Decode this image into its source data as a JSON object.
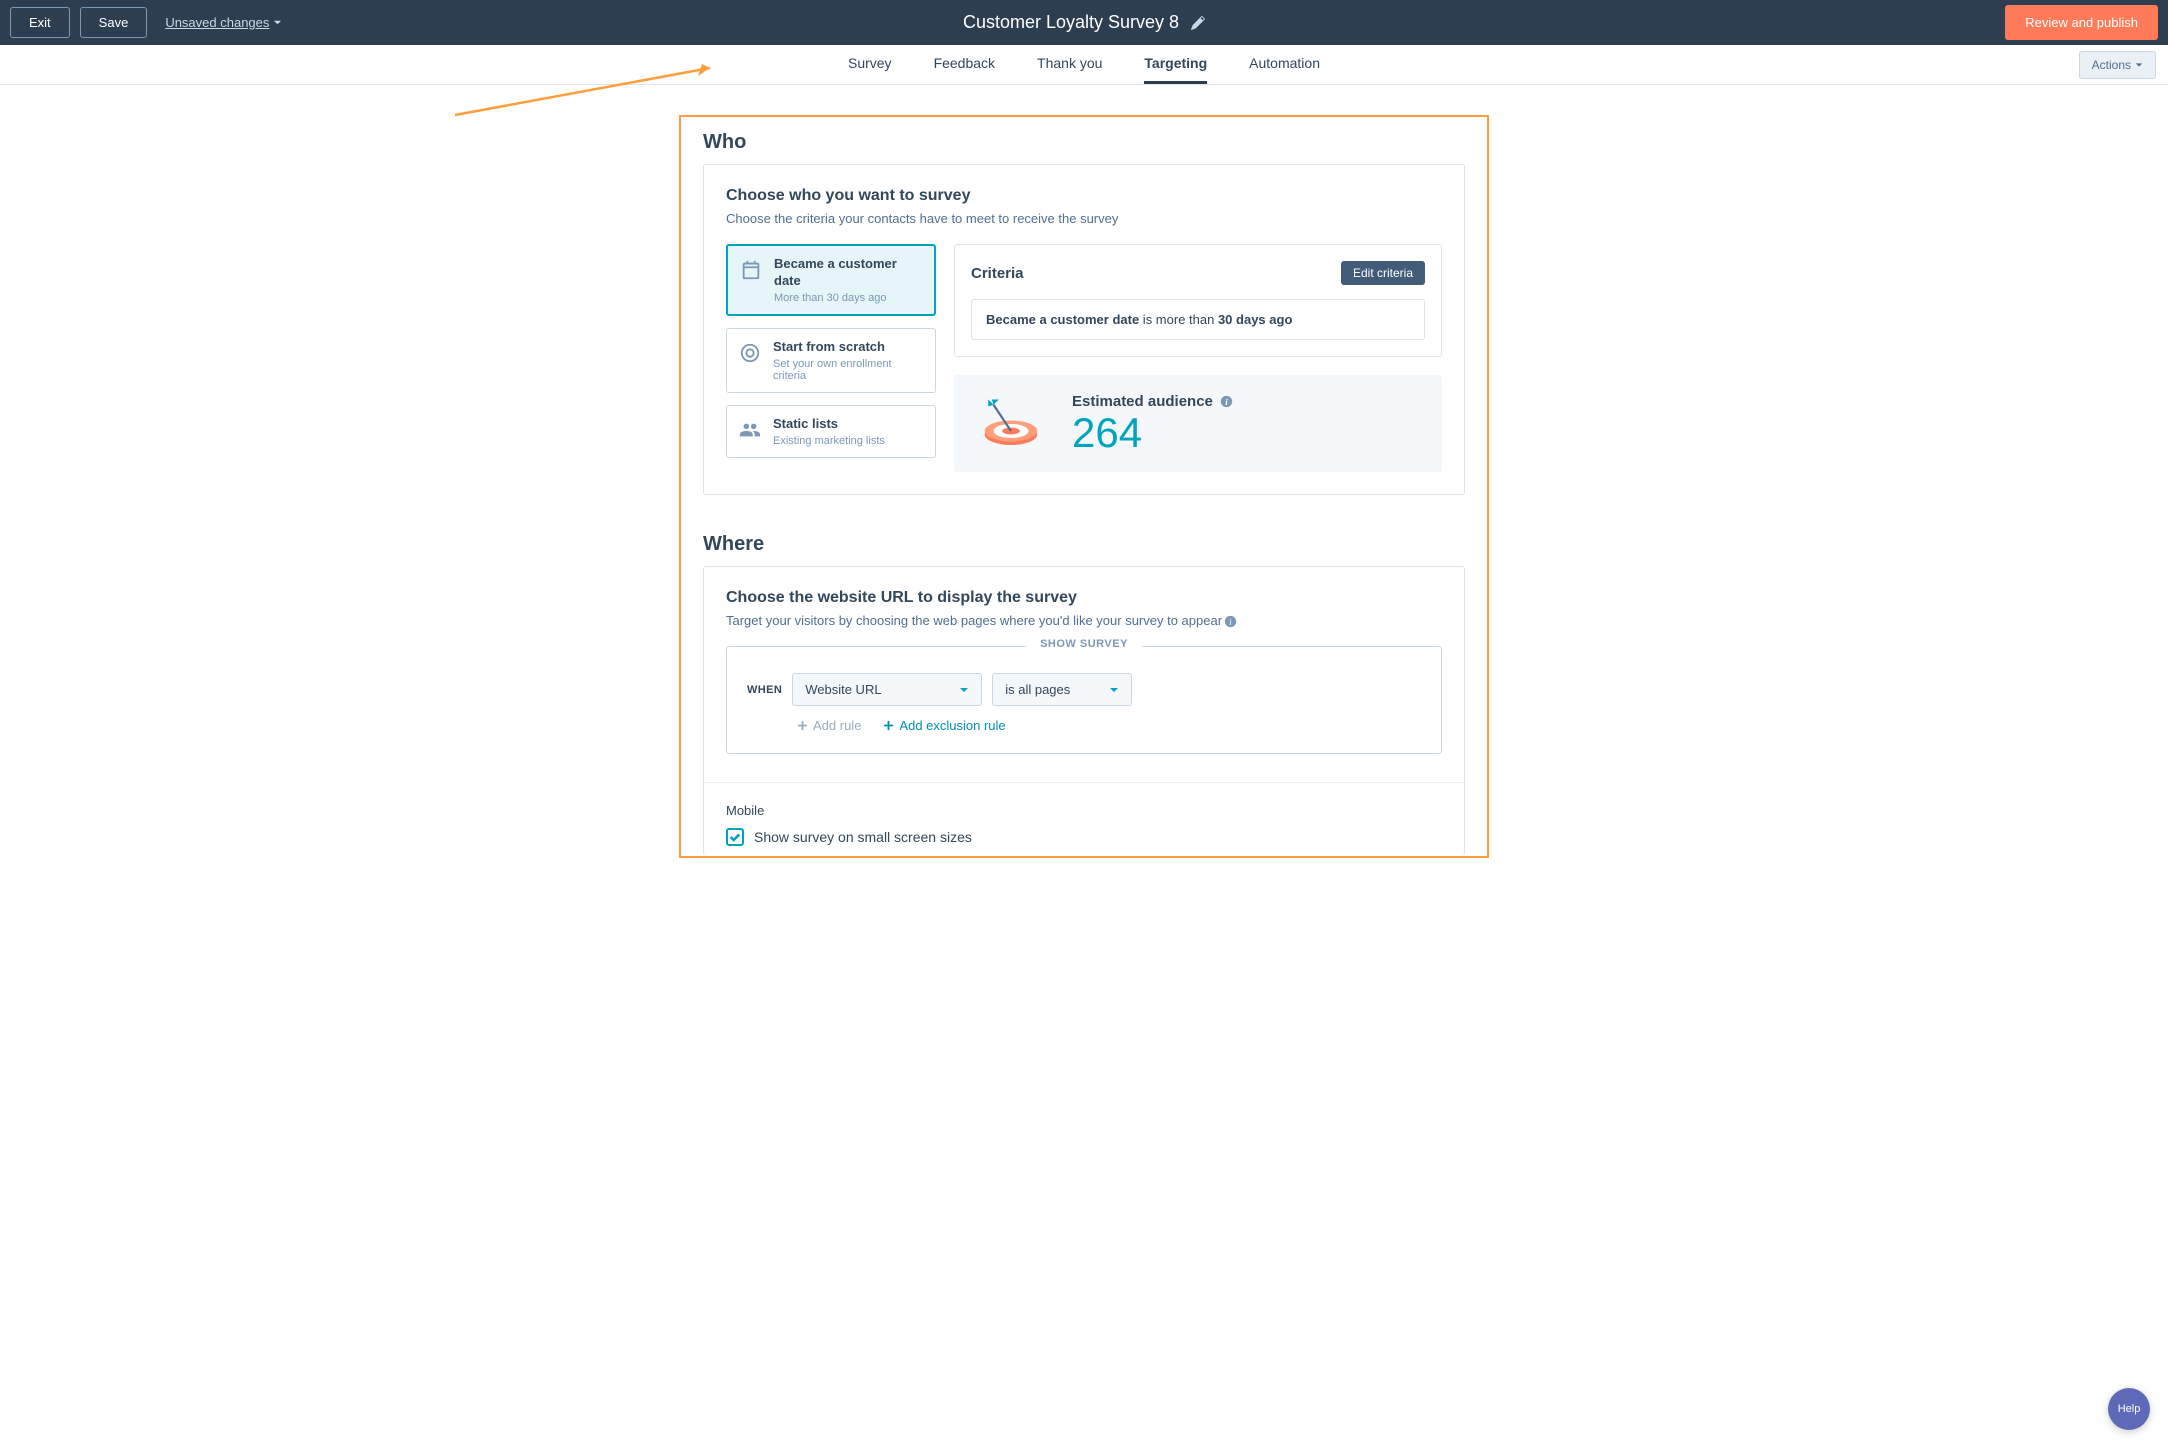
{
  "header": {
    "exit": "Exit",
    "save": "Save",
    "unsaved": "Unsaved changes",
    "title": "Customer Loyalty Survey 8",
    "review": "Review and publish"
  },
  "tabs": {
    "survey": "Survey",
    "feedback": "Feedback",
    "thankyou": "Thank you",
    "targeting": "Targeting",
    "automation": "Automation",
    "actions": "Actions"
  },
  "who": {
    "heading": "Who",
    "panel_title": "Choose who you want to survey",
    "panel_sub": "Choose the criteria your contacts have to meet to receive the survey",
    "opt1_title": "Became a customer date",
    "opt1_sub": "More than 30 days ago",
    "opt2_title": "Start from scratch",
    "opt2_sub": "Set your own enrollment criteria",
    "opt3_title": "Static lists",
    "opt3_sub": "Existing marketing lists",
    "criteria_label": "Criteria",
    "edit": "Edit criteria",
    "rule_field": "Became a customer date",
    "rule_middle": " is more than ",
    "rule_value": "30 days ago",
    "audience_label": "Estimated audience",
    "audience_value": "264"
  },
  "where": {
    "heading": "Where",
    "panel_title": "Choose the website URL to display the survey",
    "panel_sub": "Target your visitors by choosing the web pages where you'd like your survey to appear",
    "legend": "SHOW SURVEY",
    "when": "WHEN",
    "select1": "Website URL",
    "select2": "is all pages",
    "add_rule": "Add rule",
    "add_exclusion": "Add exclusion rule",
    "mobile_label": "Mobile",
    "mobile_check": "Show survey on small screen sizes"
  },
  "help": "Help"
}
